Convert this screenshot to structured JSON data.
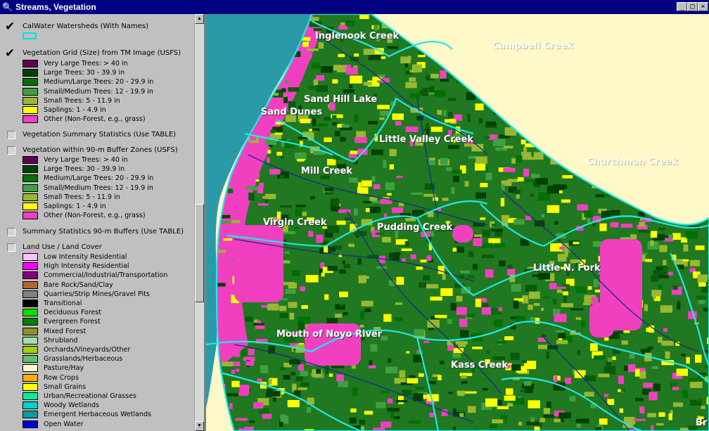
{
  "window": {
    "title": "Streams, Vegetation",
    "app_icon": "magnifier-icon",
    "buttons": [
      "_",
      "□",
      "×"
    ]
  },
  "legend": {
    "layers": [
      {
        "name": "CalWater Watersheds (With Names)",
        "checked": true,
        "outline_color": "#00e0e0",
        "entries": []
      },
      {
        "name": "Vegetation Grid (Size) from TM Image (USFS)",
        "checked": true,
        "entries": [
          {
            "label": "Very Large Trees: > 40  in",
            "color": "#600050"
          },
          {
            "label": "Large Trees: 30 - 39.9 in",
            "color": "#004000"
          },
          {
            "label": "Medium/Large Trees: 20 - 29.9 in",
            "color": "#007000"
          },
          {
            "label": "Small/Medium Trees: 12 - 19.9 in",
            "color": "#40a040"
          },
          {
            "label": "Small Trees: 5 - 11.9 in",
            "color": "#98b830"
          },
          {
            "label": "Saplings: 1 - 4.9 in",
            "color": "#ffff00"
          },
          {
            "label": "Other (Non-Forest, e.g., grass)",
            "color": "#f040c0"
          }
        ]
      },
      {
        "name": "Vegetation Summary Statistics (Use TABLE)",
        "checked": false,
        "entries": []
      },
      {
        "name": "Vegetation within 90-m Buffer Zones (USFS)",
        "checked": false,
        "entries": [
          {
            "label": "Very Large Trees: > 40  in",
            "color": "#600050"
          },
          {
            "label": "Large Trees: 30 - 39.9 in",
            "color": "#004000"
          },
          {
            "label": "Medium/Large Trees: 20 - 29.9 in",
            "color": "#007000"
          },
          {
            "label": "Small/Medium Trees: 12 - 19.9 in",
            "color": "#40a040"
          },
          {
            "label": "Small Trees: 5 - 11.9 in",
            "color": "#98b830"
          },
          {
            "label": "Saplings: 1 - 4.9 in",
            "color": "#ffff00"
          },
          {
            "label": "Other (Non-Forest, e.g., grass)",
            "color": "#f040c0"
          }
        ]
      },
      {
        "name": "Summary Statistics 90-m Buffers (Use TABLE)",
        "checked": false,
        "entries": []
      },
      {
        "name": "Land Use / Land Cover",
        "checked": false,
        "entries": [
          {
            "label": "Low Intensity Residential",
            "color": "#ffc0ff"
          },
          {
            "label": "High Intensity Residential",
            "color": "#ff00ff"
          },
          {
            "label": "Commercial/Industrial/Transportation",
            "color": "#800080"
          },
          {
            "label": "Bare Rock/Sand/Clay",
            "color": "#b06830"
          },
          {
            "label": "Quarries/Strip Mines/Gravel Pits",
            "color": "#808080"
          },
          {
            "label": "Transitional",
            "color": "#000000"
          },
          {
            "label": "Deciduous Forest",
            "color": "#00e000"
          },
          {
            "label": "Evergreen Forest",
            "color": "#008000"
          },
          {
            "label": "Mixed Forest",
            "color": "#909030"
          },
          {
            "label": "Shrubland",
            "color": "#a0e0a0"
          },
          {
            "label": "Orchards/Vineyards/Other",
            "color": "#a0d000"
          },
          {
            "label": "Grasslands/Herbaceous",
            "color": "#60c070"
          },
          {
            "label": "Pasture/Hay",
            "color": "#fff8c8"
          },
          {
            "label": "Row Crops",
            "color": "#ffb000"
          },
          {
            "label": "Small Grains",
            "color": "#ffff00"
          },
          {
            "label": "Urban/Recreational Grasses",
            "color": "#00f0a0"
          },
          {
            "label": "Woody Wetlands",
            "color": "#00d0d0"
          },
          {
            "label": "Emergent Herbaceous Wetlands",
            "color": "#00a0a0"
          },
          {
            "label": "Open Water",
            "color": "#0000d0"
          }
        ]
      }
    ]
  },
  "map": {
    "labels": [
      {
        "text": "Inglenook Creek"
      },
      {
        "text": "Campbell Creek"
      },
      {
        "text": "Sand Hill Lake"
      },
      {
        "text": "Sand Dunes"
      },
      {
        "text": "Little Valley Creek"
      },
      {
        "text": "Mill Creek"
      },
      {
        "text": "Churchman Creek"
      },
      {
        "text": "Virgin Creek"
      },
      {
        "text": "Pudding Creek"
      },
      {
        "text": "Little N. Fork"
      },
      {
        "text": "Mouth of Noyo River"
      },
      {
        "text": "Kass Creek"
      },
      {
        "text": "Br"
      }
    ]
  }
}
